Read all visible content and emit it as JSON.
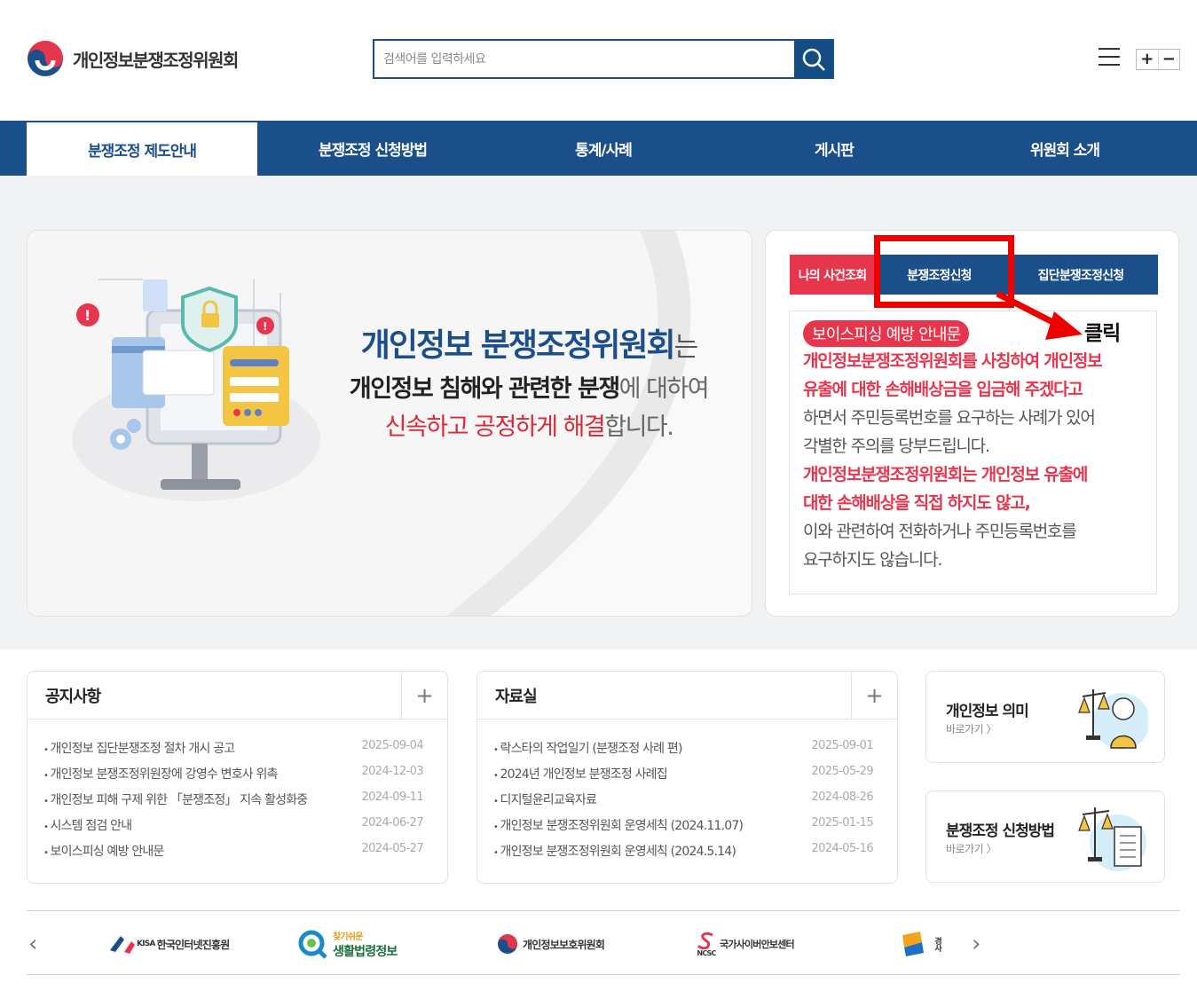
{
  "header": {
    "logo_text": "개인정보분쟁조정위원회",
    "search_placeholder": "검색어를 입력하세요",
    "zoom_in": "+",
    "zoom_out": "−"
  },
  "nav": {
    "items": [
      {
        "label": "분쟁조정 제도안내",
        "active": true
      },
      {
        "label": "분쟁조정 신청방법"
      },
      {
        "label": "통계/사례"
      },
      {
        "label": "게시판"
      },
      {
        "label": "위원회 소개"
      }
    ]
  },
  "hero": {
    "title": "개인정보 분쟁조정위원회",
    "title_suffix": "는",
    "line2_bold": "개인정보 침해와 관련한 분쟁",
    "line2_rest": "에 대하여",
    "line3_red": "신속하고 공정하게 해결",
    "line3_rest": "합니다."
  },
  "panel": {
    "tabs": [
      "나의 사건조회",
      "분쟁조정신청",
      "집단분쟁조정신청"
    ],
    "annotation": "클릭",
    "notice_badge": "보이스피싱 예방 안내문",
    "notice_lines": [
      {
        "text": "개인정보분쟁조정위원회를 사칭하여 개인정보",
        "emph": true
      },
      {
        "text": "유출에 대한 손해배상금을 입금해 주겠다고",
        "emph": true
      },
      {
        "text": "하면서 주민등록번호를 요구하는 사례가 있어",
        "emph": false
      },
      {
        "text": "각별한 주의를 당부드립니다.",
        "emph": false
      },
      {
        "text": "개인정보분쟁조정위원회는 개인정보 유출에",
        "emph": true
      },
      {
        "text": "대한 손해배상을 직접 하지도 않고,",
        "emph": true
      },
      {
        "text": "이와 관련하여 전화하거나 주민등록번호를",
        "emph": false
      },
      {
        "text": "요구하지도 않습니다.",
        "emph": false
      }
    ]
  },
  "notices": {
    "title": "공지사항",
    "plus": "+",
    "items": [
      {
        "title": "개인정보 집단분쟁조정 절차 개시 공고",
        "date": "2025-09-04"
      },
      {
        "title": "개인정보 분쟁조정위원장에 강영수 변호사 위촉",
        "date": "2024-12-03"
      },
      {
        "title": "개인정보 피해 구제 위한 「분쟁조정」 지속 활성화중",
        "date": "2024-09-11"
      },
      {
        "title": "시스템 점검 안내",
        "date": "2024-06-27"
      },
      {
        "title": "보이스피싱 예방 안내문",
        "date": "2024-05-27"
      }
    ]
  },
  "resources": {
    "title": "자료실",
    "plus": "+",
    "items": [
      {
        "title": "락스타의 작업일기 (분쟁조정 사례 편)",
        "date": "2025-09-01"
      },
      {
        "title": "2024년 개인정보 분쟁조정 사례집",
        "date": "2025-05-29"
      },
      {
        "title": "디지털윤리교육자료",
        "date": "2024-08-26"
      },
      {
        "title": "개인정보 분쟁조정위원회 운영세칙 (2024.11.07)",
        "date": "2025-01-15"
      },
      {
        "title": "개인정보 분쟁조정위원회 운영세칙 (2024.5.14)",
        "date": "2024-05-16"
      }
    ]
  },
  "links": [
    {
      "title": "개인정보 의미",
      "sub": "바로가기 〉"
    },
    {
      "title": "분쟁조정 신청방법",
      "sub": "바로가기 〉"
    }
  ],
  "partners": {
    "prev": "‹",
    "next": "›",
    "items": [
      {
        "prefix": "KISA",
        "name": "한국인터넷진흥원"
      },
      {
        "prefix": "찾기쉬운",
        "name": "생활법령정보"
      },
      {
        "prefix": "",
        "name": "개인정보보호위원회"
      },
      {
        "prefix": "NCSC",
        "name": "국가사이버안보센터"
      },
      {
        "prefix": "",
        "name": "경사"
      }
    ]
  },
  "colors": {
    "brand_blue": "#1b4f8a",
    "accent_red": "#e8354e",
    "annotation_red": "#ee0000"
  }
}
